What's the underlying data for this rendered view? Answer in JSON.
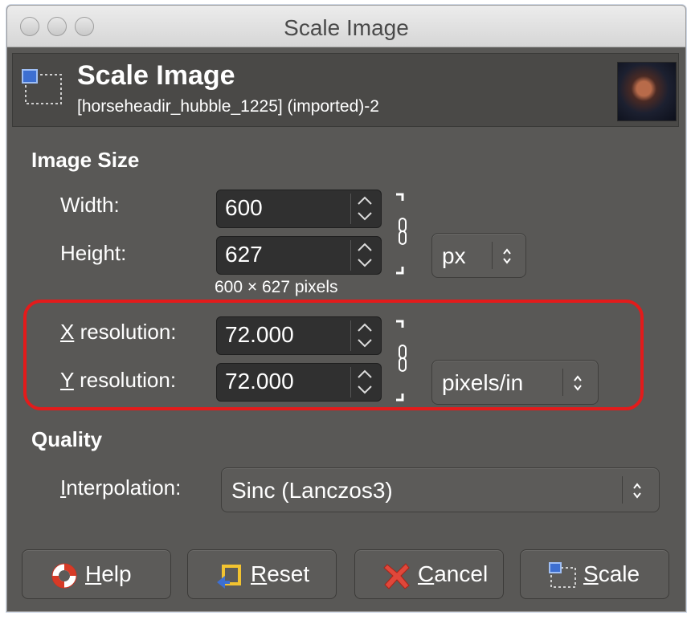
{
  "window": {
    "title": "Scale Image"
  },
  "header": {
    "title": "Scale Image",
    "subtitle": "[horseheadir_hubble_1225] (imported)-2",
    "thumbnail": "image-thumbnail"
  },
  "image_size": {
    "section_label": "Image Size",
    "width_label": "Width:",
    "width_value": "600",
    "height_label": "Height:",
    "height_value": "627",
    "unit": "px",
    "pixels_note": "600 × 627 pixels",
    "chain_linked": true
  },
  "resolution": {
    "x_label": "X resolution:",
    "x_value": "72.000",
    "y_label": "Y resolution:",
    "y_value": "72.000",
    "unit": "pixels/in",
    "chain_linked": true
  },
  "quality": {
    "section_label": "Quality",
    "interpolation_label": "Interpolation:",
    "interpolation_value": "Sinc (Lanczos3)"
  },
  "buttons": {
    "help": "Help",
    "reset": "Reset",
    "cancel": "Cancel",
    "scale": "Scale"
  },
  "colors": {
    "highlight": "#e31b1b",
    "background": "#595856",
    "field": "#303030"
  }
}
